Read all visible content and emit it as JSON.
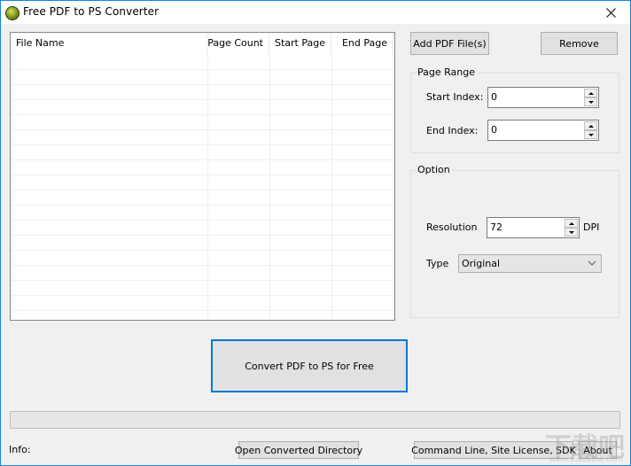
{
  "window": {
    "title": "Free PDF to PS Converter",
    "icon": "app-globe-icon",
    "close_icon": "close-icon"
  },
  "file_list": {
    "columns": [
      {
        "label": "File Name",
        "align": "left"
      },
      {
        "label": "Page Count",
        "align": "right"
      },
      {
        "label": "Start Page",
        "align": "right"
      },
      {
        "label": "End Page",
        "align": "right"
      }
    ],
    "rows": []
  },
  "buttons": {
    "add_pdf": "Add PDF File(s)",
    "remove": "Remove",
    "convert": "Convert PDF to PS for Free",
    "open_dir": "Open Converted Directory",
    "command_line": "Command Line, Site License, SDK",
    "about": "About"
  },
  "page_range": {
    "group_label": "Page Range",
    "start_label": "Start Index:",
    "start_value": "0",
    "end_label": "End Index:",
    "end_value": "0"
  },
  "option": {
    "group_label": "Option",
    "resolution_label": "Resolution",
    "resolution_value": "72",
    "resolution_unit": "DPI",
    "type_label": "Type",
    "type_value": "Original"
  },
  "progress": {
    "percent": 0
  },
  "status": {
    "info_label": "Info:"
  },
  "watermark": {
    "text": "下载吧",
    "sub": "www.xiazaiba.com"
  }
}
